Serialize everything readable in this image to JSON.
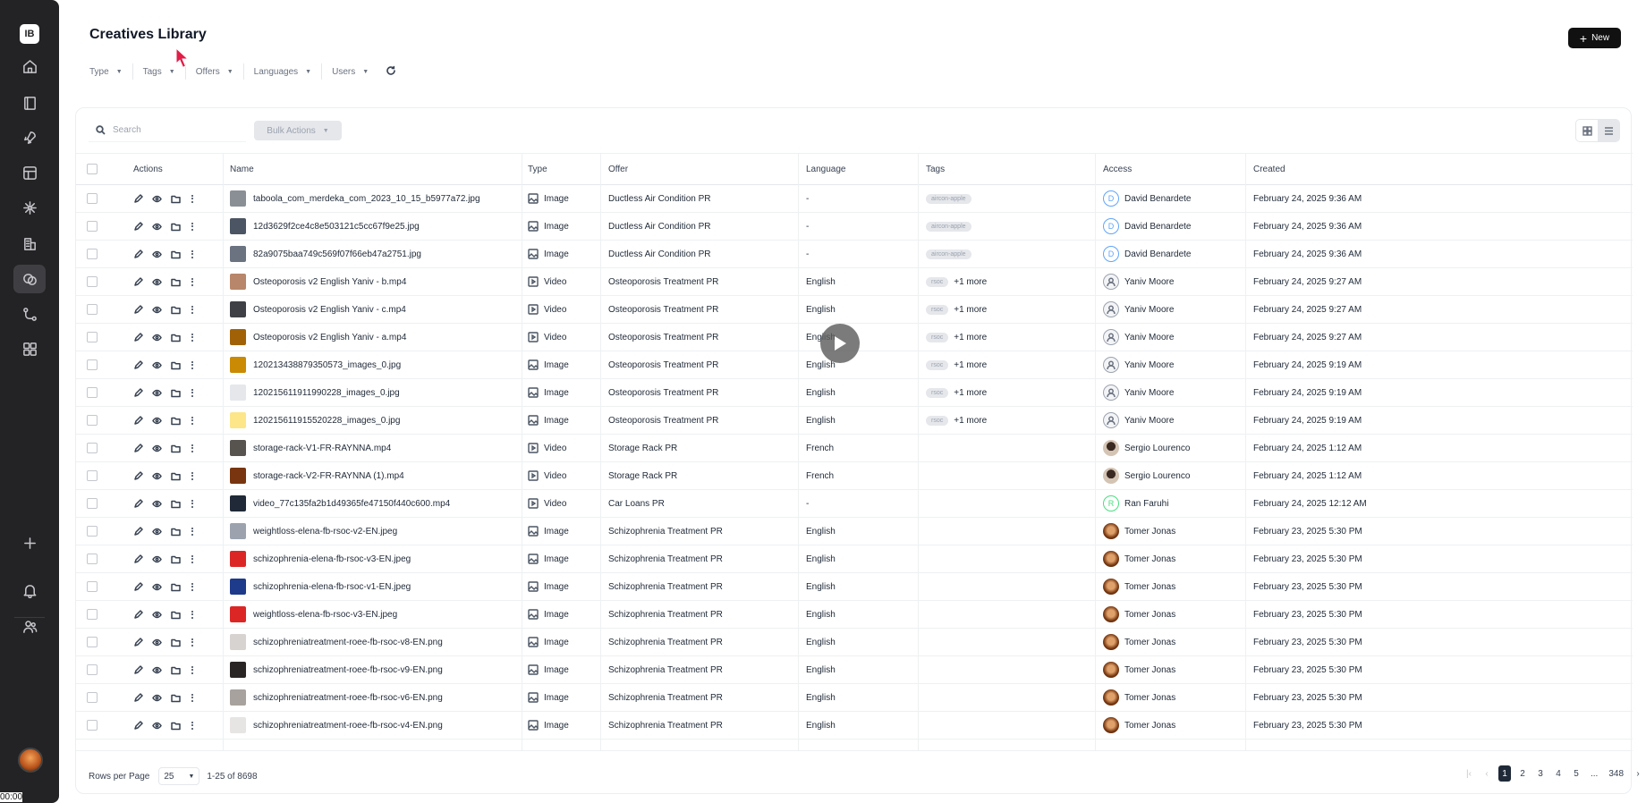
{
  "app": {
    "logo_text": "IB",
    "title": "Creatives Library",
    "new_button": "New",
    "timer_text": "00:00"
  },
  "sidebar": {
    "items": [
      {
        "icon": "home-icon"
      },
      {
        "icon": "book-icon"
      },
      {
        "icon": "rocket-icon"
      },
      {
        "icon": "layout-icon"
      },
      {
        "icon": "network-icon"
      },
      {
        "icon": "building-icon"
      },
      {
        "icon": "creatives-icon",
        "active": true
      },
      {
        "icon": "flow-icon"
      },
      {
        "icon": "apps-icon"
      }
    ],
    "bottom": [
      {
        "icon": "plus-icon"
      },
      {
        "icon": "bell-icon"
      },
      {
        "icon": "users-icon"
      }
    ]
  },
  "filters": {
    "items": [
      "Type",
      "Tags",
      "Offers",
      "Languages",
      "Users"
    ]
  },
  "toolbar": {
    "search_placeholder": "Search",
    "bulk_actions": "Bulk Actions"
  },
  "table": {
    "columns": [
      "Actions",
      "Name",
      "Type",
      "Offer",
      "Language",
      "Tags",
      "Access",
      "Created"
    ],
    "rows": [
      {
        "name": "taboola_com_merdeka_com_2023_10_15_b5977a72.jpg",
        "type": "Image",
        "offer": "Ductless Air Condition PR",
        "language": "-",
        "tags": [
          "aircon-apple"
        ],
        "more": "",
        "access": "David Benardete",
        "avatar": "letter",
        "avatar_letter": "D",
        "avatar_color": "#60a5fa",
        "created": "February 24, 2025 9:36 AM",
        "thumb": "#8a8f96"
      },
      {
        "name": "12d3629f2ce4c8e503121c5cc67f9e25.jpg",
        "type": "Image",
        "offer": "Ductless Air Condition PR",
        "language": "-",
        "tags": [
          "aircon-apple"
        ],
        "more": "",
        "access": "David Benardete",
        "avatar": "letter",
        "avatar_letter": "D",
        "avatar_color": "#60a5fa",
        "created": "February 24, 2025 9:36 AM",
        "thumb": "#4b5563"
      },
      {
        "name": "82a9075baa749c569f07f66eb47a2751.jpg",
        "type": "Image",
        "offer": "Ductless Air Condition PR",
        "language": "-",
        "tags": [
          "aircon-apple"
        ],
        "more": "",
        "access": "David Benardete",
        "avatar": "letter",
        "avatar_letter": "D",
        "avatar_color": "#60a5fa",
        "created": "February 24, 2025 9:36 AM",
        "thumb": "#6b7280"
      },
      {
        "name": "Osteoporosis v2 English Yaniv - b.mp4",
        "type": "Video",
        "offer": "Osteoporosis Treatment PR",
        "language": "English",
        "tags": [
          "rsoc"
        ],
        "more": "+1 more",
        "access": "Yaniv Moore",
        "avatar": "person",
        "created": "February 24, 2025 9:27 AM",
        "thumb": "#b8866a"
      },
      {
        "name": "Osteoporosis v2 English Yaniv - c.mp4",
        "type": "Video",
        "offer": "Osteoporosis Treatment PR",
        "language": "English",
        "tags": [
          "rsoc"
        ],
        "more": "+1 more",
        "access": "Yaniv Moore",
        "avatar": "person",
        "created": "February 24, 2025 9:27 AM",
        "thumb": "#3f3f46"
      },
      {
        "name": "Osteoporosis v2 English Yaniv - a.mp4",
        "type": "Video",
        "offer": "Osteoporosis Treatment PR",
        "language": "English",
        "tags": [
          "rsoc"
        ],
        "more": "+1 more",
        "access": "Yaniv Moore",
        "avatar": "person",
        "created": "February 24, 2025 9:27 AM",
        "thumb": "#a16207"
      },
      {
        "name": "120213438879350573_images_0.jpg",
        "type": "Image",
        "offer": "Osteoporosis Treatment PR",
        "language": "English",
        "tags": [
          "rsoc"
        ],
        "more": "+1 more",
        "access": "Yaniv Moore",
        "avatar": "person",
        "created": "February 24, 2025 9:19 AM",
        "thumb": "#ca8a04"
      },
      {
        "name": "120215611911990228_images_0.jpg",
        "type": "Image",
        "offer": "Osteoporosis Treatment PR",
        "language": "English",
        "tags": [
          "rsoc"
        ],
        "more": "+1 more",
        "access": "Yaniv Moore",
        "avatar": "person",
        "created": "February 24, 2025 9:19 AM",
        "thumb": "#e5e7eb"
      },
      {
        "name": "120215611915520228_images_0.jpg",
        "type": "Image",
        "offer": "Osteoporosis Treatment PR",
        "language": "English",
        "tags": [
          "rsoc"
        ],
        "more": "+1 more",
        "access": "Yaniv Moore",
        "avatar": "person",
        "created": "February 24, 2025 9:19 AM",
        "thumb": "#fde68a"
      },
      {
        "name": "storage-rack-V1-FR-RAYNNA.mp4",
        "type": "Video",
        "offer": "Storage Rack PR",
        "language": "French",
        "tags": [],
        "more": "",
        "access": "Sergio Lourenco",
        "avatar": "photo-s",
        "created": "February 24, 2025 1:12 AM",
        "thumb": "#57534e"
      },
      {
        "name": "storage-rack-V2-FR-RAYNNA (1).mp4",
        "type": "Video",
        "offer": "Storage Rack PR",
        "language": "French",
        "tags": [],
        "more": "",
        "access": "Sergio Lourenco",
        "avatar": "photo-s",
        "created": "February 24, 2025 1:12 AM",
        "thumb": "#78350f"
      },
      {
        "name": "video_77c135fa2b1d49365fe47150f440c600.mp4",
        "type": "Video",
        "offer": "Car Loans PR",
        "language": "-",
        "tags": [],
        "more": "",
        "access": "Ran Faruhi",
        "avatar": "letter",
        "avatar_letter": "R",
        "avatar_color": "#4ade80",
        "created": "February 24, 2025 12:12 AM",
        "thumb": "#1f2937"
      },
      {
        "name": "weightloss-elena-fb-rsoc-v2-EN.jpeg",
        "type": "Image",
        "offer": "Schizophrenia Treatment PR",
        "language": "English",
        "tags": [],
        "more": "",
        "access": "Tomer Jonas",
        "avatar": "photo-t",
        "created": "February 23, 2025 5:30 PM",
        "thumb": "#9ca3af"
      },
      {
        "name": "schizophrenia-elena-fb-rsoc-v3-EN.jpeg",
        "type": "Image",
        "offer": "Schizophrenia Treatment PR",
        "language": "English",
        "tags": [],
        "more": "",
        "access": "Tomer Jonas",
        "avatar": "photo-t",
        "created": "February 23, 2025 5:30 PM",
        "thumb": "#dc2626"
      },
      {
        "name": "schizophrenia-elena-fb-rsoc-v1-EN.jpeg",
        "type": "Image",
        "offer": "Schizophrenia Treatment PR",
        "language": "English",
        "tags": [],
        "more": "",
        "access": "Tomer Jonas",
        "avatar": "photo-t",
        "created": "February 23, 2025 5:30 PM",
        "thumb": "#1e3a8a"
      },
      {
        "name": "weightloss-elena-fb-rsoc-v3-EN.jpeg",
        "type": "Image",
        "offer": "Schizophrenia Treatment PR",
        "language": "English",
        "tags": [],
        "more": "",
        "access": "Tomer Jonas",
        "avatar": "photo-t",
        "created": "February 23, 2025 5:30 PM",
        "thumb": "#dc2626"
      },
      {
        "name": "schizophreniatreatment-roee-fb-rsoc-v8-EN.png",
        "type": "Image",
        "offer": "Schizophrenia Treatment PR",
        "language": "English",
        "tags": [],
        "more": "",
        "access": "Tomer Jonas",
        "avatar": "photo-t",
        "created": "February 23, 2025 5:30 PM",
        "thumb": "#d6d3d1"
      },
      {
        "name": "schizophreniatreatment-roee-fb-rsoc-v9-EN.png",
        "type": "Image",
        "offer": "Schizophrenia Treatment PR",
        "language": "English",
        "tags": [],
        "more": "",
        "access": "Tomer Jonas",
        "avatar": "photo-t",
        "created": "February 23, 2025 5:30 PM",
        "thumb": "#292524"
      },
      {
        "name": "schizophreniatreatment-roee-fb-rsoc-v6-EN.png",
        "type": "Image",
        "offer": "Schizophrenia Treatment PR",
        "language": "English",
        "tags": [],
        "more": "",
        "access": "Tomer Jonas",
        "avatar": "photo-t",
        "created": "February 23, 2025 5:30 PM",
        "thumb": "#a8a29e"
      },
      {
        "name": "schizophreniatreatment-roee-fb-rsoc-v4-EN.png",
        "type": "Image",
        "offer": "Schizophrenia Treatment PR",
        "language": "English",
        "tags": [],
        "more": "",
        "access": "Tomer Jonas",
        "avatar": "photo-t",
        "created": "February 23, 2025 5:30 PM",
        "thumb": "#e7e5e4"
      }
    ]
  },
  "footer": {
    "rows_per_page_label": "Rows per Page",
    "rows_per_page_value": "25",
    "range": "1-25 of 8698",
    "pages": [
      "1",
      "2",
      "3",
      "4",
      "5",
      "...",
      "348"
    ],
    "current_page": "1"
  }
}
